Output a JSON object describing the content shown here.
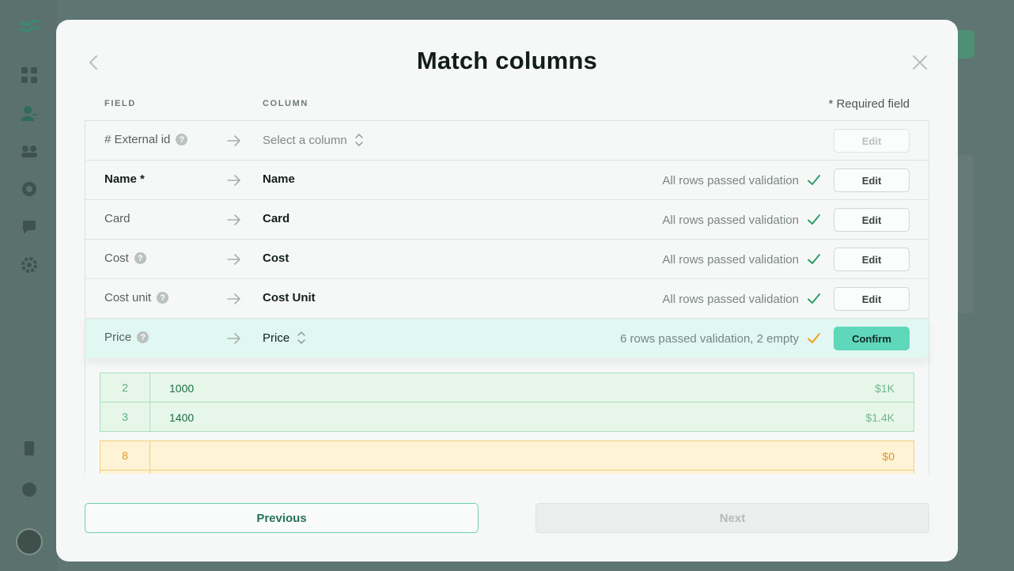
{
  "modal": {
    "title": "Match columns",
    "field_header": "FIELD",
    "column_header": "COLUMN",
    "required_note": "* Required field"
  },
  "rows": [
    {
      "field": "# External id",
      "column": "Select a column",
      "status": "",
      "button": "Edit"
    },
    {
      "field": "Name *",
      "column": "Name",
      "status": "All rows passed validation",
      "button": "Edit"
    },
    {
      "field": "Card",
      "column": "Card",
      "status": "All rows passed validation",
      "button": "Edit"
    },
    {
      "field": "Cost",
      "column": "Cost",
      "status": "All rows passed validation",
      "button": "Edit"
    },
    {
      "field": "Cost unit",
      "column": "Cost Unit",
      "status": "All rows passed validation",
      "button": "Edit"
    },
    {
      "field": "Price",
      "column": "Price",
      "status": "6 rows passed validation, 2 empty",
      "button": "Confirm"
    }
  ],
  "preview": [
    {
      "index": "2",
      "value": "1000",
      "formatted": "$1K",
      "state": "valid"
    },
    {
      "index": "3",
      "value": "1400",
      "formatted": "$1.4K",
      "state": "valid"
    },
    {
      "index": "8",
      "value": "",
      "formatted": "$0",
      "state": "empty"
    }
  ],
  "footer": {
    "previous_label": "Previous",
    "next_label": "Next"
  },
  "icons": {
    "help": "?"
  },
  "colors": {
    "accent": "#5fd7bb",
    "valid_check": "#2e9e6a",
    "warning_check": "#f0a020"
  }
}
